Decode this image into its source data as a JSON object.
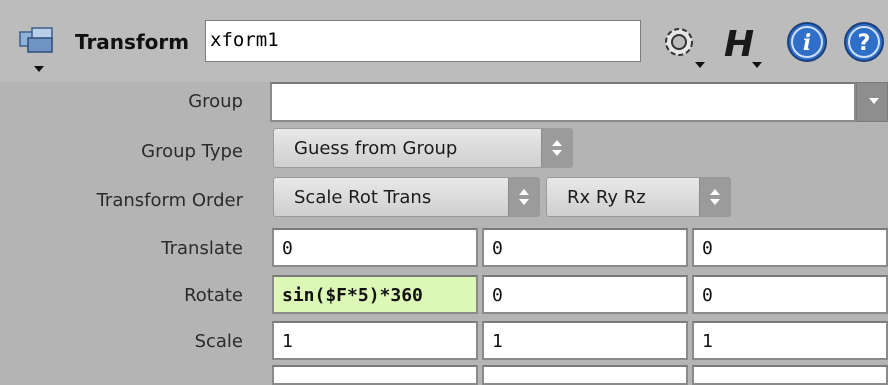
{
  "header": {
    "node_type": "Transform",
    "node_name": "xform1",
    "icons": [
      "node-type-icon",
      "gear-icon",
      "houdini-help-icon",
      "info-icon",
      "help-icon"
    ]
  },
  "parms": {
    "group": {
      "label": "Group",
      "value": ""
    },
    "group_type": {
      "label": "Group Type",
      "value": "Guess from Group"
    },
    "transform_order": {
      "label": "Transform Order",
      "value": "Scale Rot Trans",
      "rot_order": "Rx Ry Rz"
    },
    "translate": {
      "label": "Translate",
      "values": [
        "0",
        "0",
        "0"
      ]
    },
    "rotate": {
      "label": "Rotate",
      "values": [
        "sin($F*5)*360",
        "0",
        "0"
      ]
    },
    "scale": {
      "label": "Scale",
      "values": [
        "1",
        "1",
        "1"
      ]
    }
  },
  "colors": {
    "background": "#b4b4b4",
    "expression_field": "#ddf7b7",
    "info_icon": "#2f6fc9"
  }
}
